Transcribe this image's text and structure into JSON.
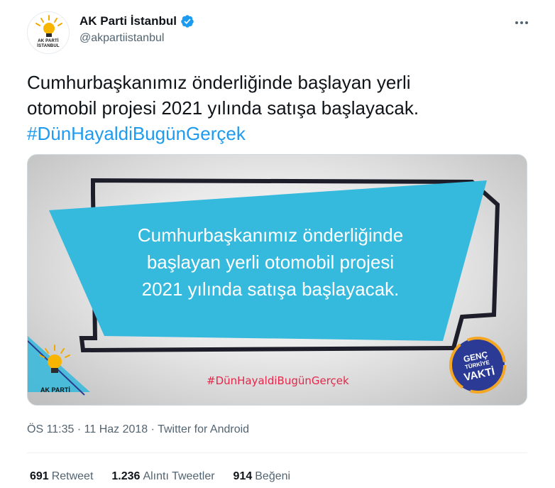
{
  "user": {
    "display_name": "AK Parti İstanbul",
    "handle": "@akpartiistanbul",
    "avatar_text_line1": "AK PARTİ",
    "avatar_text_line2": "İSTANBUL",
    "verified": true
  },
  "tweet": {
    "text_line1": "Cumhurbaşkanımız önderliğinde başlayan yerli",
    "text_line2": "otomobil projesi 2021 yılında satışa başlayacak.",
    "hashtag": "#DünHayaldiBugünGerçek"
  },
  "media": {
    "caption_line1": "Cumhurbaşkanımız önderliğinde",
    "caption_line2": "başlayan yerli otomobil projesi",
    "caption_line3": "2021 yılında satışa başlayacak.",
    "hashtag": "#DünHayaldiBugünGerçek",
    "logo_text": "AK PARTİ",
    "badge_line1": "GENÇ",
    "badge_line2": "TÜRKİYE",
    "badge_line3": "VAKTİ"
  },
  "meta": {
    "text": "ÖS 11:35 · 11 Haz 2018 · Twitter for Android"
  },
  "stats": {
    "retweets_count": "691",
    "retweets_label": "Retweet",
    "quotes_count": "1.236",
    "quotes_label": "Alıntı Tweetler",
    "likes_count": "914",
    "likes_label": "Beğeni"
  },
  "colors": {
    "link": "#1d9bf0",
    "verified": "#1d9bf0",
    "banner": "#35b9dd",
    "media_hashtag": "#e3274a",
    "secondary_text": "#536471"
  },
  "icons": {
    "verified": "verified-badge-icon",
    "more": "more-horizontal-icon",
    "logo": "lightbulb-logo-icon"
  }
}
